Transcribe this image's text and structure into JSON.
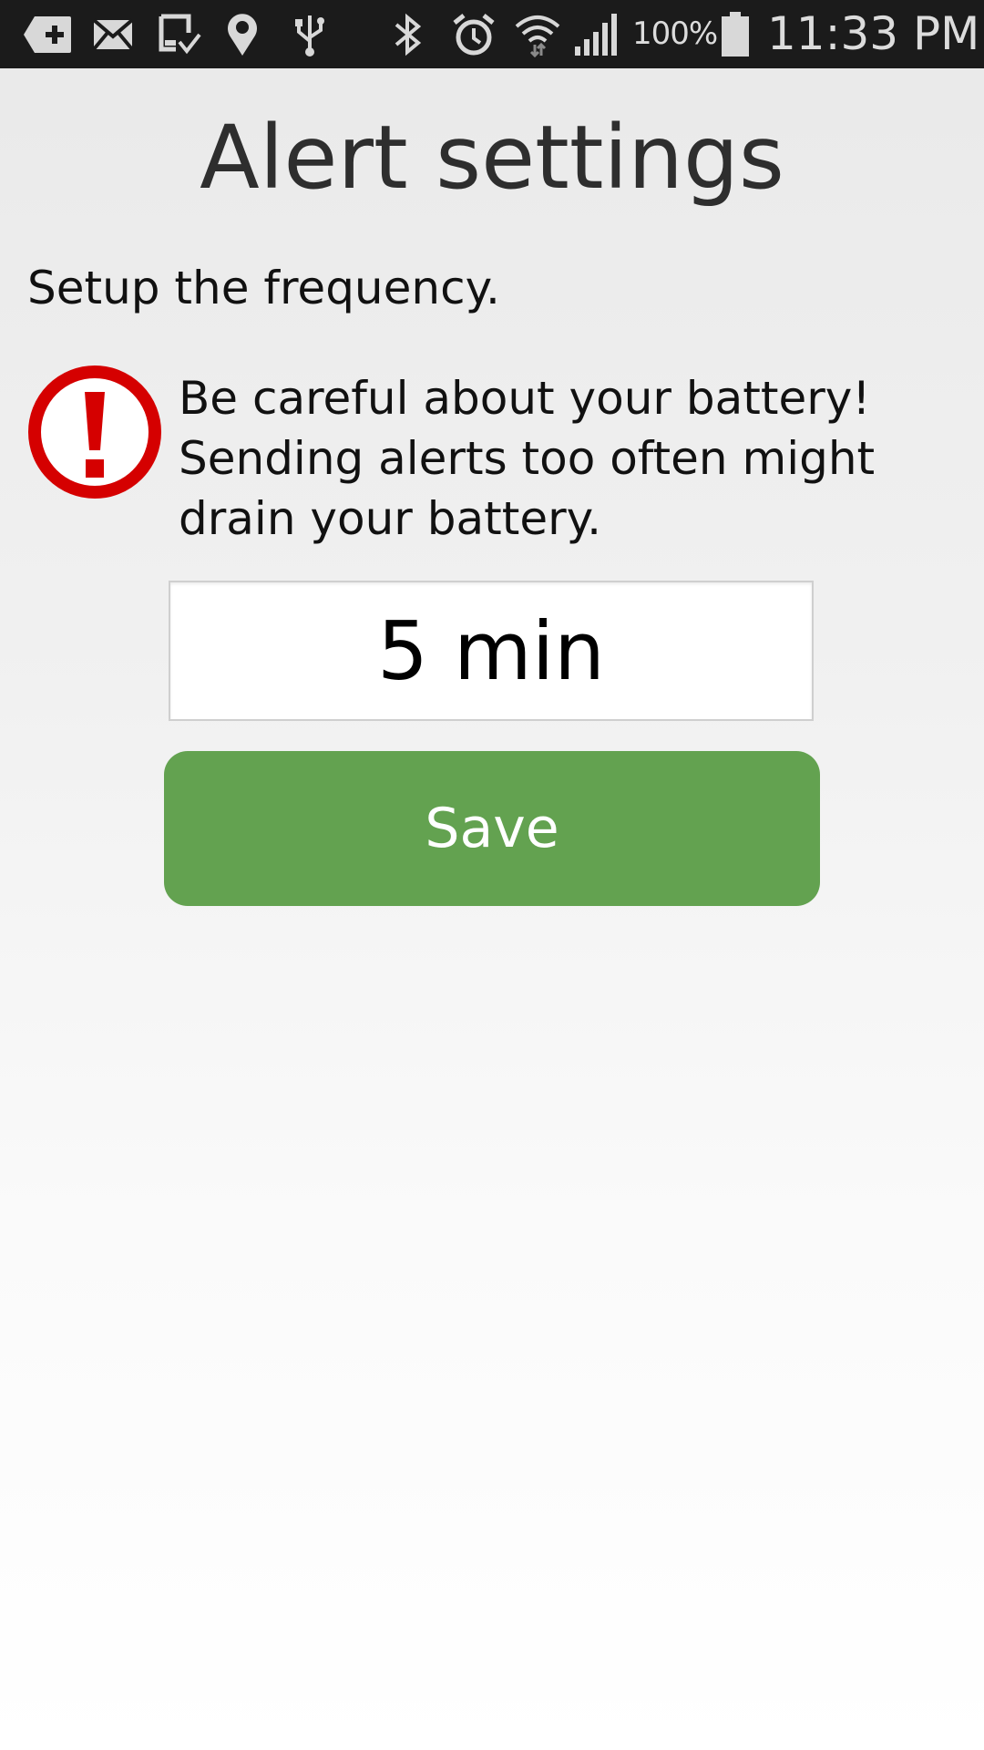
{
  "status_bar": {
    "icons": [
      "add-icon",
      "mail-icon",
      "download-done-icon",
      "location-icon",
      "usb-icon",
      "bluetooth-icon",
      "alarm-icon",
      "wifi-icon",
      "signal-icon",
      "battery-icon"
    ],
    "battery_percent": "100%",
    "time": "11:33 PM"
  },
  "page": {
    "title": "Alert settings",
    "subtitle": "Setup the frequency."
  },
  "warning": {
    "icon": "alert-icon",
    "color": "#d50000",
    "lines": [
      "Be careful about your battery!",
      "Sending alerts too often might",
      "drain your battery."
    ]
  },
  "frequency": {
    "value": "5 min"
  },
  "actions": {
    "save_label": "Save",
    "save_color": "#63a250"
  }
}
